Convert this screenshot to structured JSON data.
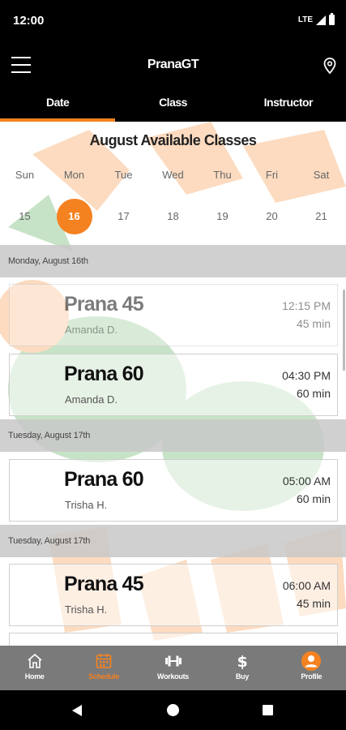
{
  "status": {
    "time": "12:00",
    "network": "LTE"
  },
  "app": {
    "title": "PranaGT"
  },
  "tabs": [
    {
      "label": "Date",
      "active": true
    },
    {
      "label": "Class",
      "active": false
    },
    {
      "label": "Instructor",
      "active": false
    }
  ],
  "calendar": {
    "title": "August Available Classes",
    "weekdays": [
      "Sun",
      "Mon",
      "Tue",
      "Wed",
      "Thu",
      "Fri",
      "Sat"
    ],
    "days": [
      "15",
      "16",
      "17",
      "18",
      "19",
      "20",
      "21"
    ],
    "selected_day": "16"
  },
  "sections": [
    {
      "header": "Monday, August 16th",
      "classes": [
        {
          "name": "Prana 45",
          "instructor": "Amanda D.",
          "time": "12:15 PM",
          "duration": "45 min",
          "faded": true
        },
        {
          "name": "Prana 60",
          "instructor": "Amanda D.",
          "time": "04:30 PM",
          "duration": "60 min",
          "faded": false
        }
      ]
    },
    {
      "header": "Tuesday, August 17th",
      "classes": [
        {
          "name": "Prana 60",
          "instructor": "Trisha H.",
          "time": "05:00 AM",
          "duration": "60 min",
          "faded": false
        }
      ]
    },
    {
      "header": "Tuesday, August 17th",
      "classes": [
        {
          "name": "Prana 45",
          "instructor": "Trisha H.",
          "time": "06:00 AM",
          "duration": "45 min",
          "faded": false
        }
      ]
    }
  ],
  "bottom_nav": [
    {
      "label": "Home",
      "icon": "home-icon",
      "active": false
    },
    {
      "label": "Schedule",
      "icon": "calendar-icon",
      "active": true
    },
    {
      "label": "Workouts",
      "icon": "dumbbell-icon",
      "active": false
    },
    {
      "label": "Buy",
      "icon": "dollar-icon",
      "active": false
    },
    {
      "label": "Profile",
      "icon": "profile-icon",
      "active": false
    }
  ],
  "colors": {
    "accent": "#f58220",
    "nav_background": "#7a7a7a",
    "header_background": "#000000"
  }
}
